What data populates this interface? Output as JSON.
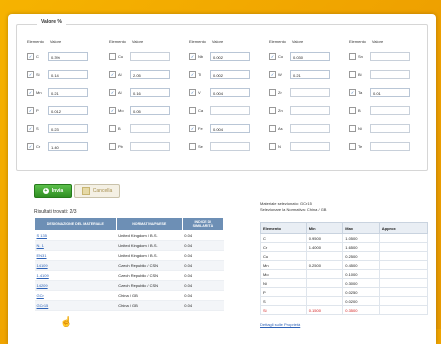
{
  "fieldset": {
    "legend": "Valore %"
  },
  "columns": [
    {
      "head_element": "Elemento",
      "head_value": "Valore",
      "rows": [
        {
          "el": "C",
          "checked": true,
          "value": "0.3%"
        },
        {
          "el": "Si",
          "checked": true,
          "value": "0.14"
        },
        {
          "el": "Mn",
          "checked": true,
          "value": "0.21"
        },
        {
          "el": "P",
          "checked": true,
          "value": "0.012"
        },
        {
          "el": "S",
          "checked": true,
          "value": "0.23"
        },
        {
          "el": "Cr",
          "checked": true,
          "value": "1.40"
        }
      ]
    },
    {
      "head_element": "Elemento",
      "head_value": "Valore",
      "rows": [
        {
          "el": "Cu",
          "checked": false,
          "value": ""
        },
        {
          "el": "Al",
          "checked": true,
          "value": "2.05"
        },
        {
          "el": "Al",
          "checked": true,
          "value": "0.16"
        },
        {
          "el": "Mo",
          "checked": true,
          "value": "0.05"
        },
        {
          "el": "B",
          "checked": false,
          "value": ""
        },
        {
          "el": "Pb",
          "checked": false,
          "value": ""
        }
      ]
    },
    {
      "head_element": "Elemento",
      "head_value": "Valore",
      "rows": [
        {
          "el": "Nb",
          "checked": true,
          "value": "0.002"
        },
        {
          "el": "Ti",
          "checked": true,
          "value": "0.002"
        },
        {
          "el": "V",
          "checked": true,
          "value": "0.004"
        },
        {
          "el": "Ca",
          "checked": false,
          "value": ""
        },
        {
          "el": "Fe",
          "checked": true,
          "value": "0.004"
        },
        {
          "el": "Se",
          "checked": false,
          "value": ""
        }
      ]
    },
    {
      "head_element": "Elemento",
      "head_value": "Valore",
      "rows": [
        {
          "el": "Co",
          "checked": true,
          "value": "0.030"
        },
        {
          "el": "W",
          "checked": true,
          "value": "0.21"
        },
        {
          "el": "Zr",
          "checked": false,
          "value": ""
        },
        {
          "el": "Zn",
          "checked": false,
          "value": ""
        },
        {
          "el": "As",
          "checked": false,
          "value": ""
        },
        {
          "el": "N",
          "checked": false,
          "value": ""
        }
      ]
    },
    {
      "head_element": "Elemento",
      "head_value": "Valore",
      "rows": [
        {
          "el": "Sn",
          "checked": false,
          "value": ""
        },
        {
          "el": "Bi",
          "checked": false,
          "value": ""
        },
        {
          "el": "Ta",
          "checked": true,
          "value": "0.01"
        },
        {
          "el": "B",
          "checked": false,
          "value": ""
        },
        {
          "el": "Ni",
          "checked": false,
          "value": ""
        },
        {
          "el": "Te",
          "checked": false,
          "value": ""
        }
      ]
    }
  ],
  "buttons": {
    "submit": "Invia",
    "reset": "Cancella"
  },
  "results": {
    "title": "Risultati trovati: 2/3",
    "headers": [
      "DESIGNAZIONE DEL MATERIALE",
      "NORMATIVA/PAESE",
      "INDICE DI SIMILARITÀ"
    ],
    "rows": [
      {
        "name": "S 135",
        "norm": "United Kingdom / B.S.",
        "idx": "0.04"
      },
      {
        "name": "N. 1",
        "norm": "United Kingdom / B.S.",
        "idx": "0.04"
      },
      {
        "name": "EN31",
        "norm": "United Kingdom / B.S.",
        "idx": "0.04"
      },
      {
        "name": "14109",
        "norm": "Czech Republic / CSN",
        "idx": "0.04"
      },
      {
        "name": "1.4109",
        "norm": "Czech Republic / CSN",
        "idx": "0.04"
      },
      {
        "name": "14209",
        "norm": "Czech Republic / CSN",
        "idx": "0.04"
      },
      {
        "name": "GCr",
        "norm": "China / GB",
        "idx": "0.04"
      },
      {
        "name": "GCr15",
        "norm": "China / GB",
        "idx": "0.04"
      }
    ]
  },
  "selection": {
    "line1": "Materiale selezionato: GCr15",
    "line2": "Selezionare la Normativa: China / GB",
    "headers": [
      "Elemento",
      "Min",
      "Max",
      "Approx"
    ],
    "rows": [
      {
        "el": "C",
        "min": "0.9500",
        "max": "1.0500",
        "approx": "",
        "red": false
      },
      {
        "el": "Cr",
        "min": "1.4000",
        "max": "1.6500",
        "approx": "",
        "red": false
      },
      {
        "el": "Cu",
        "min": "",
        "max": "0.2500",
        "approx": "",
        "red": false
      },
      {
        "el": "Mn",
        "min": "0.2500",
        "max": "0.4500",
        "approx": "",
        "red": false
      },
      {
        "el": "Mo",
        "min": "",
        "max": "0.1000",
        "approx": "",
        "red": false
      },
      {
        "el": "Ni",
        "min": "",
        "max": "0.3000",
        "approx": "",
        "red": false
      },
      {
        "el": "P",
        "min": "",
        "max": "0.0250",
        "approx": "",
        "red": false
      },
      {
        "el": "S",
        "min": "",
        "max": "0.0200",
        "approx": "",
        "red": false
      },
      {
        "el": "Si",
        "min": "0.1500",
        "max": "0.3500",
        "approx": "",
        "red": true
      }
    ]
  },
  "footer_link": "Dettagli sulle Proprietà"
}
